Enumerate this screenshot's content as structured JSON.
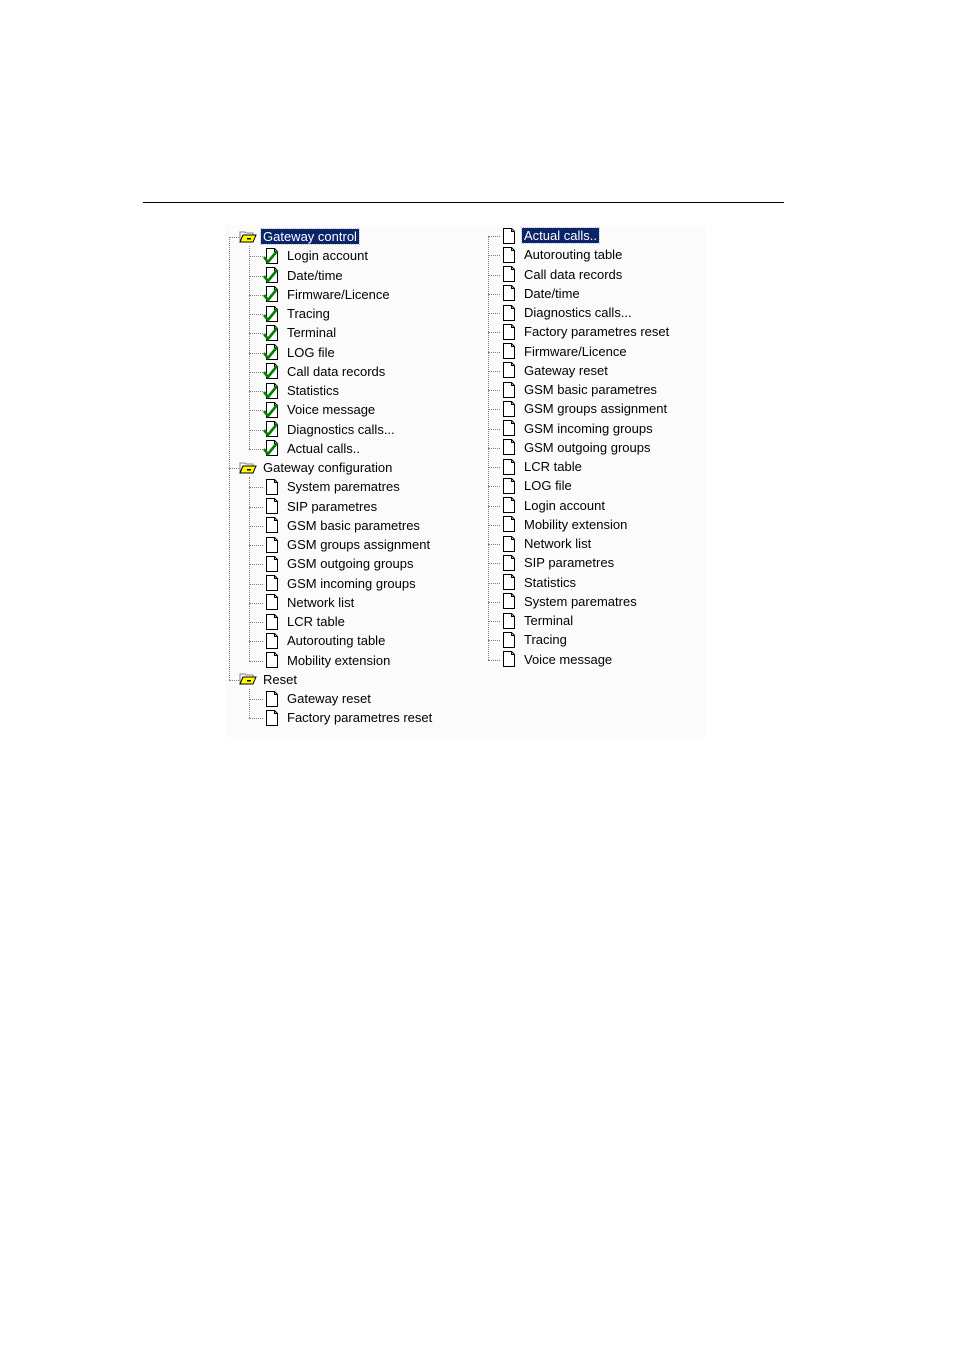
{
  "left_tree": {
    "groups": [
      {
        "label": "Gateway control",
        "selected": true,
        "icon": "folder-open-icon",
        "items": [
          {
            "label": "Login account",
            "icon": "page-check-icon"
          },
          {
            "label": "Date/time",
            "icon": "page-check-icon"
          },
          {
            "label": "Firmware/Licence",
            "icon": "page-check-icon"
          },
          {
            "label": "Tracing",
            "icon": "page-check-icon"
          },
          {
            "label": "Terminal",
            "icon": "page-check-icon"
          },
          {
            "label": "LOG file",
            "icon": "page-check-icon"
          },
          {
            "label": "Call data records",
            "icon": "page-check-icon"
          },
          {
            "label": "Statistics",
            "icon": "page-check-icon"
          },
          {
            "label": "Voice message",
            "icon": "page-check-icon"
          },
          {
            "label": "Diagnostics calls...",
            "icon": "page-check-icon"
          },
          {
            "label": "Actual calls..",
            "icon": "page-check-icon"
          }
        ]
      },
      {
        "label": "Gateway configuration",
        "selected": false,
        "icon": "folder-open-icon",
        "items": [
          {
            "label": "System parematres",
            "icon": "page-icon"
          },
          {
            "label": "SIP parametres",
            "icon": "page-icon"
          },
          {
            "label": "GSM basic parametres",
            "icon": "page-icon"
          },
          {
            "label": "GSM groups assignment",
            "icon": "page-icon"
          },
          {
            "label": "GSM outgoing groups",
            "icon": "page-icon"
          },
          {
            "label": "GSM incoming groups",
            "icon": "page-icon"
          },
          {
            "label": "Network list",
            "icon": "page-icon"
          },
          {
            "label": "LCR table",
            "icon": "page-icon"
          },
          {
            "label": "Autorouting table",
            "icon": "page-icon"
          },
          {
            "label": "Mobility extension",
            "icon": "page-icon"
          }
        ]
      },
      {
        "label": "Reset",
        "selected": false,
        "icon": "folder-open-icon",
        "items": [
          {
            "label": "Gateway reset",
            "icon": "page-icon"
          },
          {
            "label": "Factory parametres reset",
            "icon": "page-icon"
          }
        ]
      }
    ]
  },
  "right_tree": {
    "selected_index": 0,
    "items": [
      "Actual calls..",
      "Autorouting table",
      "Call data records",
      "Date/time",
      "Diagnostics calls...",
      "Factory parametres reset",
      "Firmware/Licence",
      "Gateway reset",
      "GSM basic parametres",
      "GSM groups assignment",
      "GSM incoming groups",
      "GSM outgoing groups",
      "LCR table",
      "LOG file",
      "Login account",
      "Mobility extension",
      "Network list",
      "SIP parametres",
      "Statistics",
      "System parematres",
      "Terminal",
      "Tracing",
      "Voice message"
    ]
  },
  "colors": {
    "selection": "#0a246a",
    "folder": "#ffff00",
    "check": "#008000"
  }
}
